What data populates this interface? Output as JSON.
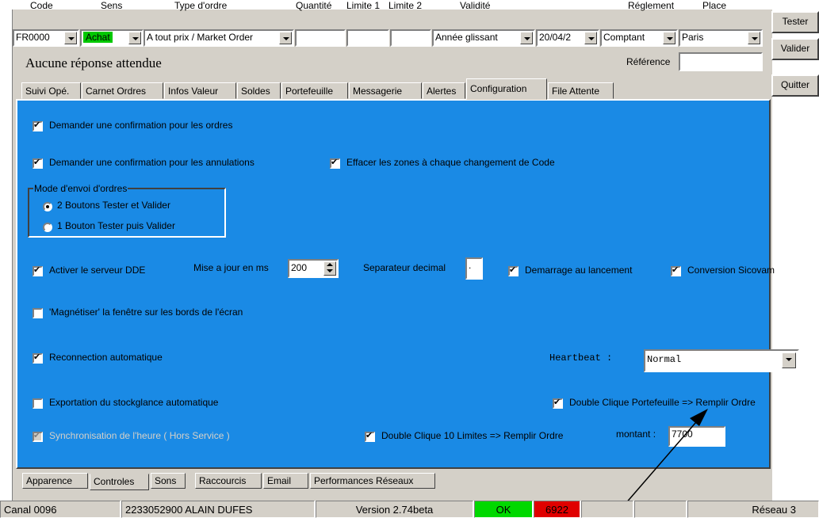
{
  "header": {
    "code": "Code",
    "sens": "Sens",
    "type_ordre": "Type d'ordre",
    "quantite": "Quantité",
    "limite1": "Limite 1",
    "limite2": "Limite 2",
    "validite": "Validité",
    "reglement": "Réglement",
    "place": "Place"
  },
  "order": {
    "code_value": "FR0000",
    "sens_value": "Achat",
    "type_value": "A tout prix / Market Order",
    "validite_value": "Année glissant",
    "date_value": "20/04/2",
    "reglement_value": "Comptant",
    "place_value": "Paris",
    "status_text": "Aucune réponse attendue",
    "reference_label": "Référence"
  },
  "buttons": {
    "tester": "Tester",
    "valider": "Valider",
    "quitter": "Quitter"
  },
  "tabs": [
    "Suivi Opé.",
    "Carnet Ordres",
    "Infos Valeur",
    "Soldes",
    "Portefeuille",
    "Messagerie",
    "Alertes",
    "Configuration",
    "File Attente"
  ],
  "config": {
    "confirm_orders": "Demander une confirmation pour les ordres",
    "confirm_cancel": "Demander une confirmation pour les annulations",
    "clear_fields": "Effacer les zones à chaque changement de Code",
    "send_mode_title": "Mode d'envoi d'ordres",
    "mode_two_buttons": "2 Boutons Tester et Valider",
    "mode_one_button": "1 Bouton Tester puis Valider",
    "dde_server": "Activer le serveur DDE",
    "update_ms_label": "Mise a jour en ms",
    "update_ms_value": "200",
    "decimal_sep_label": "Separateur decimal",
    "decimal_sep_value": ".",
    "start_on_launch": "Demarrage au lancement",
    "sicovam": "Conversion Sicovam",
    "magnetize": "'Magnétiser' la fenêtre sur les bords de l'écran",
    "reconnect": "Reconnection automatique",
    "heartbeat_label": "Heartbeat :",
    "heartbeat_value": "Normal",
    "export_stock": "Exportation du stockglance automatique",
    "dbl_portfolio": "Double Clique Portefeuille => Remplir Ordre",
    "sync_time": "Synchronisation de l'heure ( Hors Service )",
    "dbl_limits": "Double Clique 10 Limites => Remplir Ordre",
    "amount_label": "montant :",
    "amount_value": "7700"
  },
  "bottom_tabs": [
    "Apparence",
    "Controles",
    "Sons",
    "Raccourcis",
    "Email",
    "Performances Réseaux"
  ],
  "status": {
    "canal": "Canal 0096",
    "account": "2233052900  ALAIN DUFES",
    "version": "Version 2.74beta",
    "ok": "OK",
    "count": "6922",
    "network": "Réseau 3"
  },
  "colors": {
    "panel_blue": "#1a8ae5",
    "achat_green": "#00c800",
    "ok_green": "#00d800",
    "count_red": "#e00000"
  }
}
